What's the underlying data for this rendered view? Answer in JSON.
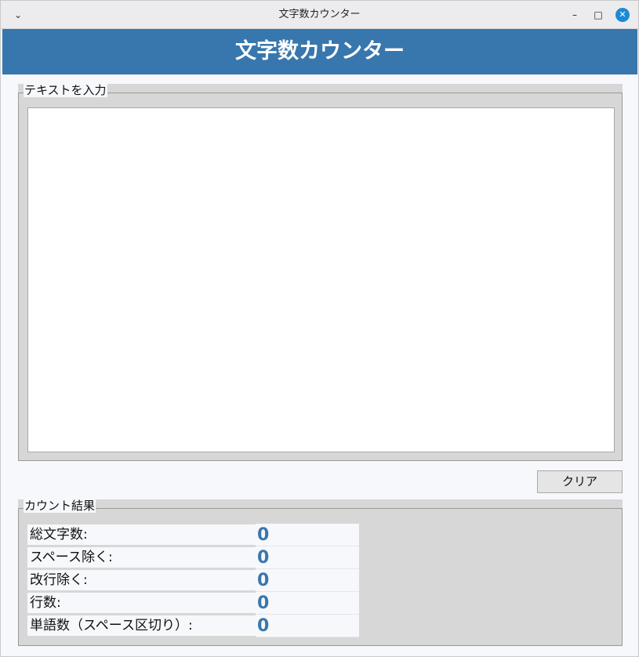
{
  "window": {
    "title": "文字数カウンター",
    "menu_icon": "chevron-down-icon",
    "minimize_icon": "minimize-icon",
    "maximize_icon": "maximize-icon",
    "close_icon": "close-icon"
  },
  "header": {
    "title": "文字数カウンター"
  },
  "input": {
    "group_label": "テキストを入力",
    "text_value": "",
    "placeholder": ""
  },
  "actions": {
    "clear_label": "クリア"
  },
  "results": {
    "group_label": "カウント結果",
    "rows": [
      {
        "label": "総文字数:",
        "value": "0"
      },
      {
        "label": "スペース除く:",
        "value": "0"
      },
      {
        "label": "改行除く:",
        "value": "0"
      },
      {
        "label": "行数:",
        "value": "0"
      },
      {
        "label": "単語数（スペース区切り）:",
        "value": "0"
      }
    ]
  },
  "colors": {
    "accent": "#3877ad",
    "close_button": "#1b8ad6",
    "value_text": "#3a77ad",
    "group_bg": "#d7d7d7"
  }
}
